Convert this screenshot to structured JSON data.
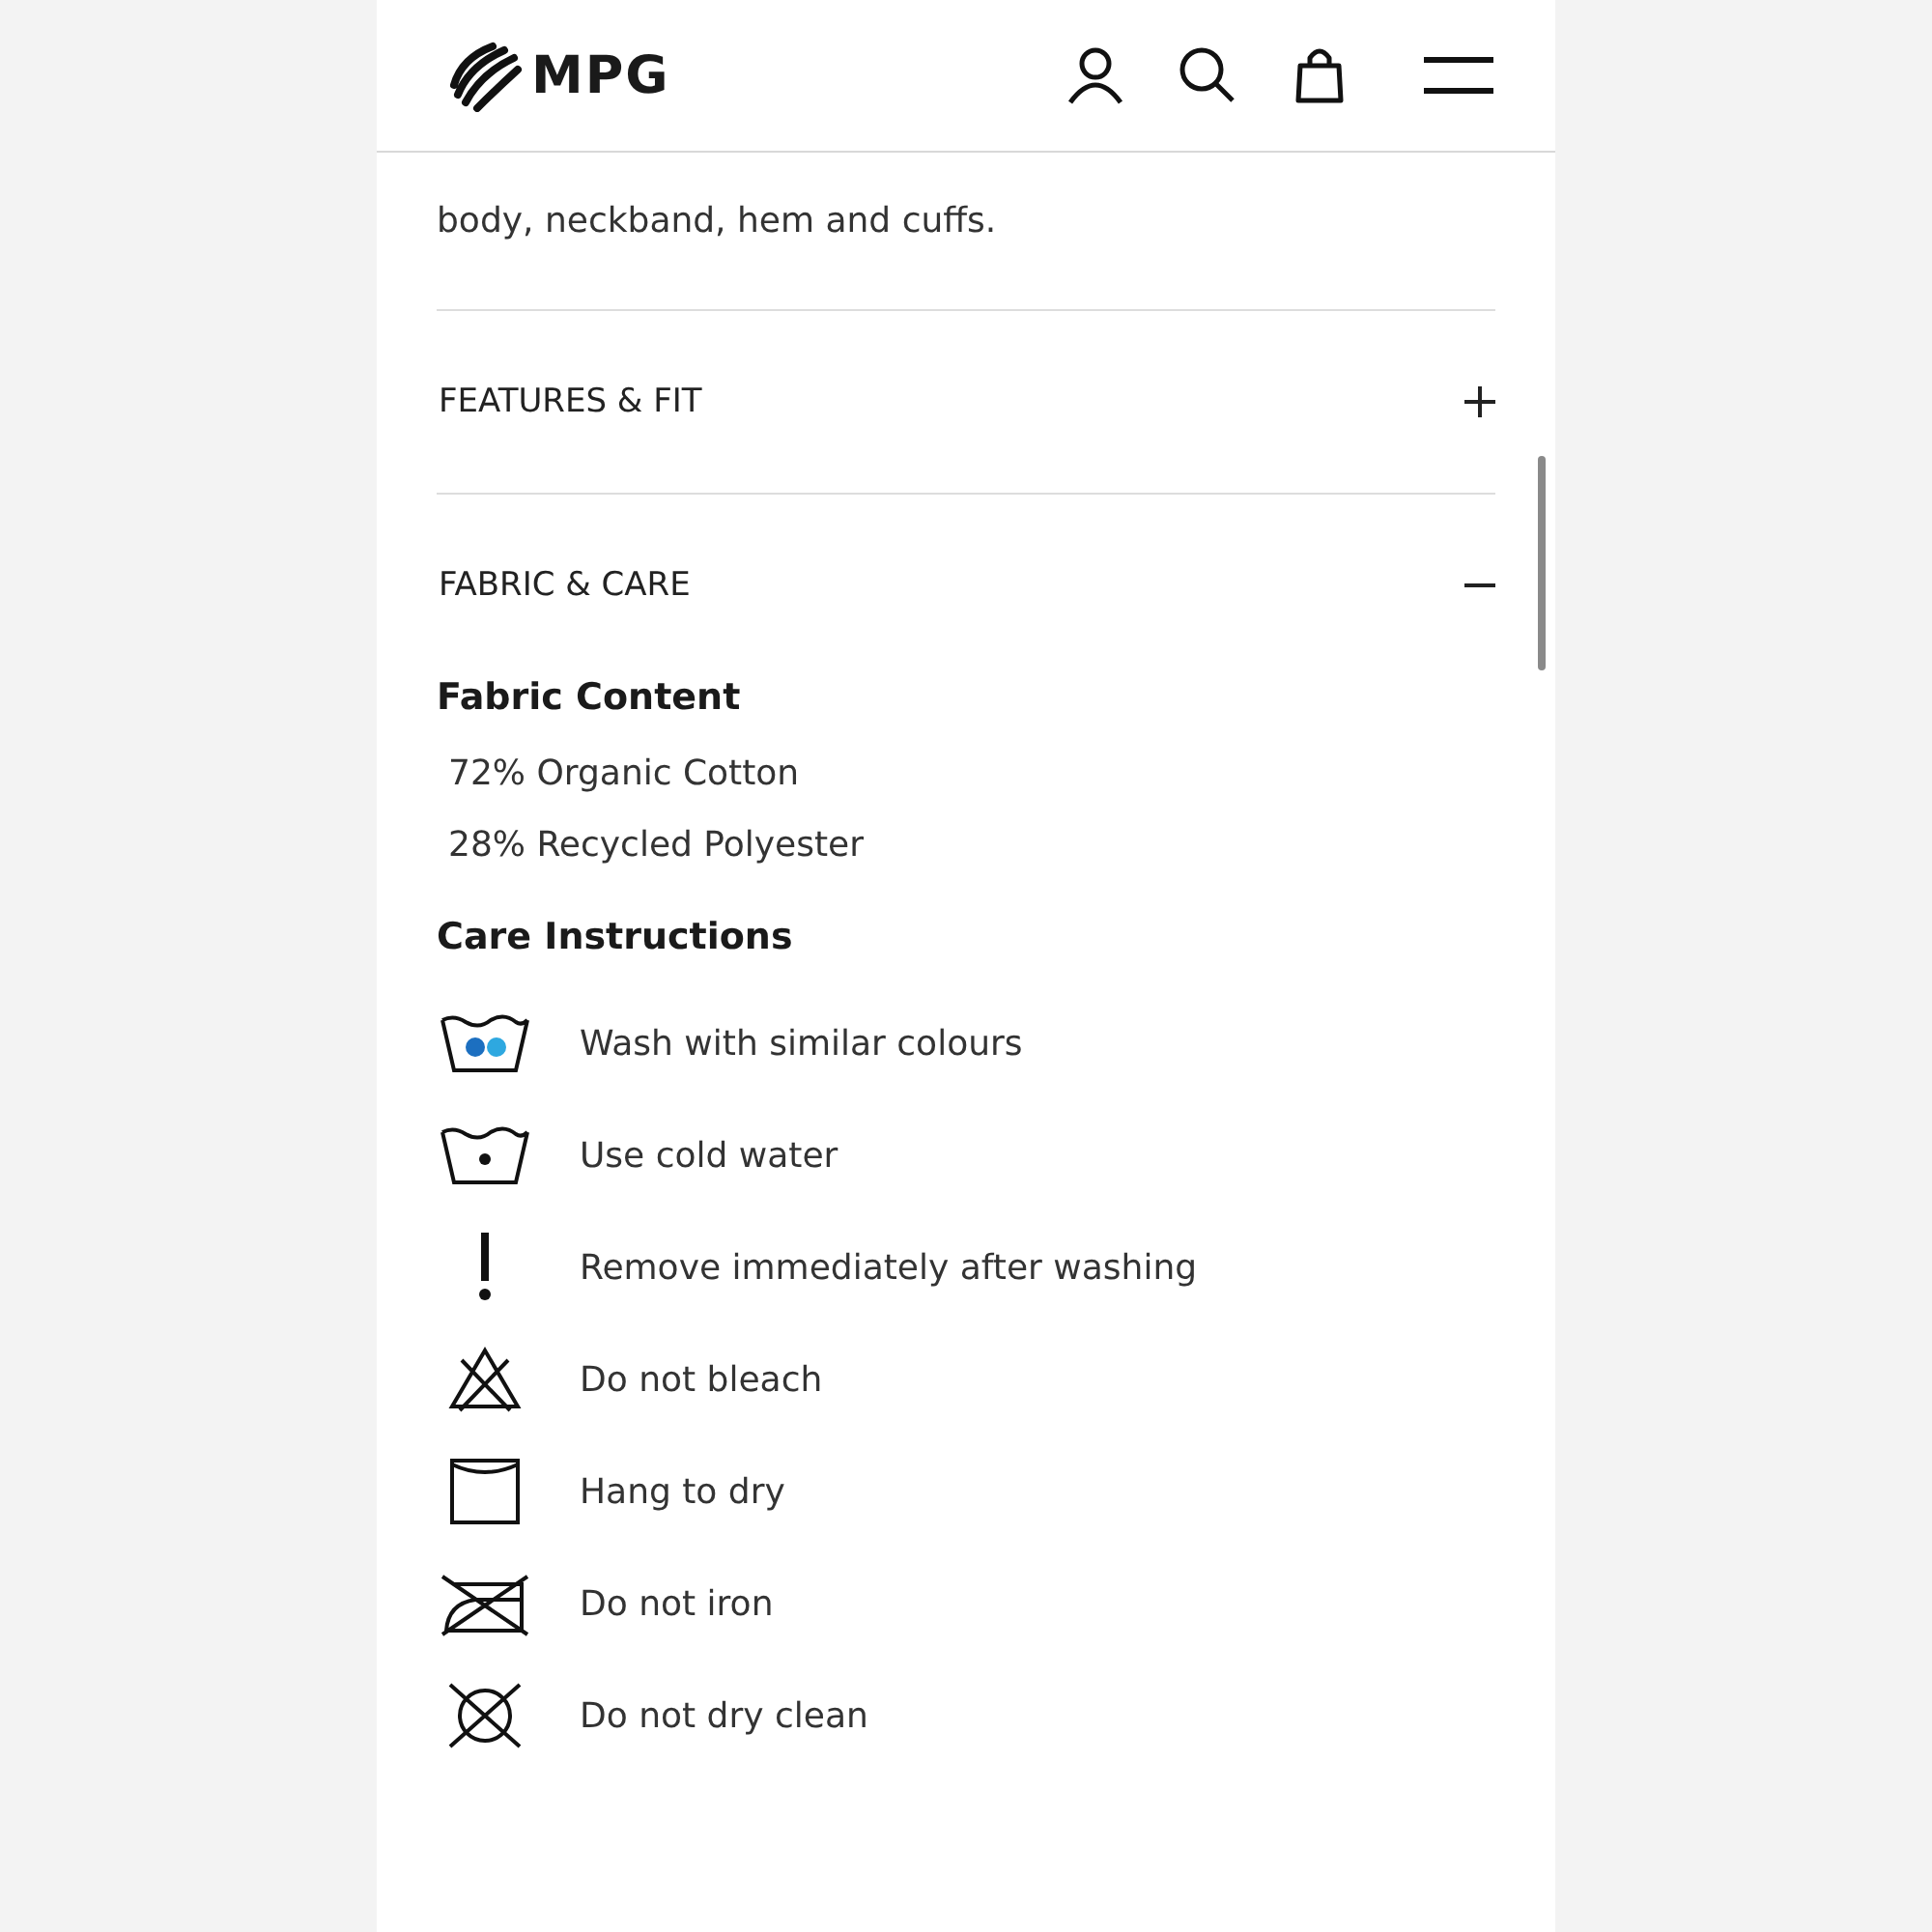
{
  "header": {
    "logo": "MPG"
  },
  "description": {
    "lines": [
      "body, neckband, hem and cuffs."
    ]
  },
  "accordions": [
    {
      "title": "FEATURES & FIT",
      "expanded": false
    },
    {
      "title": "FABRIC & CARE",
      "expanded": true
    }
  ],
  "fabric_content": {
    "heading": "Fabric Content",
    "items": [
      "72% Organic Cotton",
      "28% Recycled Polyester"
    ]
  },
  "care_instructions": {
    "heading": "Care Instructions",
    "items": [
      {
        "kind": "wash-colours",
        "text": "Wash with similar colours"
      },
      {
        "kind": "wash-cold",
        "text": "Use cold water"
      },
      {
        "kind": "remove",
        "text": "Remove immediately after washing"
      },
      {
        "kind": "no-bleach",
        "text": "Do not bleach"
      },
      {
        "kind": "hang-dry",
        "text": "Hang to dry"
      },
      {
        "kind": "no-iron",
        "text": "Do not iron"
      },
      {
        "kind": "no-dry-clean",
        "text": "Do not dry clean"
      }
    ]
  }
}
